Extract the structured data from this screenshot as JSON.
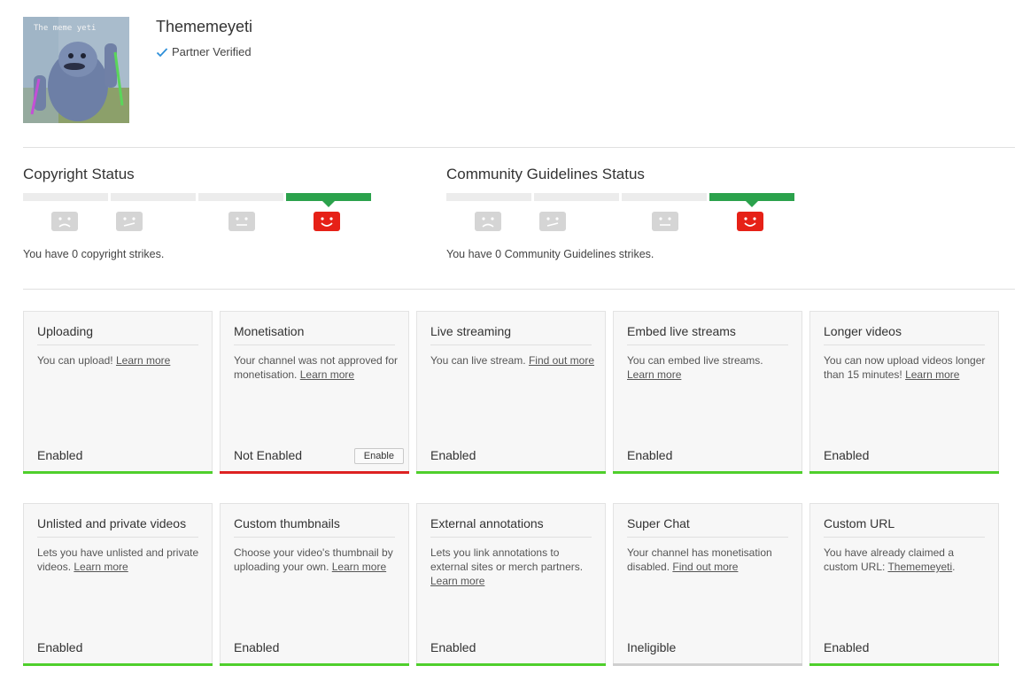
{
  "channel": {
    "name": "Thememeyeti",
    "verified_label": "Partner Verified",
    "avatar_caption": "The meme yeti"
  },
  "colors": {
    "active_strike": "#2ba24c",
    "happy_face": "#e62117",
    "inactive_face": "#d5d5d5",
    "enabled_bar": "#4fcf2c",
    "not_enabled_bar": "#dd2222",
    "ineligible_bar": "#cfcfcf"
  },
  "copyright": {
    "title": "Copyright Status",
    "text": "You have 0 copyright strikes.",
    "active_segment": 4
  },
  "community": {
    "title": "Community Guidelines Status",
    "text": "You have 0 Community Guidelines strikes.",
    "active_segment": 4
  },
  "features": [
    {
      "title": "Uploading",
      "desc": "You can upload! ",
      "link": "Learn more",
      "suffix": "",
      "status": "Enabled"
    },
    {
      "title": "Monetisation",
      "desc": "Your channel was not approved for monetisation. ",
      "link": "Learn more",
      "suffix": "",
      "status": "Not Enabled",
      "button": "Enable"
    },
    {
      "title": "Live streaming",
      "desc": "You can live stream. ",
      "link": "Find out more",
      "suffix": "",
      "status": "Enabled"
    },
    {
      "title": "Embed live streams",
      "desc": "You can embed live streams. ",
      "link": "Learn more",
      "suffix": "",
      "status": "Enabled"
    },
    {
      "title": "Longer videos",
      "desc": "You can now upload videos longer than 15 minutes! ",
      "link": "Learn more",
      "suffix": "",
      "status": "Enabled"
    },
    {
      "title": "Unlisted and private videos",
      "desc": "Lets you have unlisted and private videos. ",
      "link": "Learn more",
      "suffix": "",
      "status": "Enabled"
    },
    {
      "title": "Custom thumbnails",
      "desc": "Choose your video's thumbnail by uploading your own. ",
      "link": "Learn more",
      "suffix": "",
      "status": "Enabled"
    },
    {
      "title": "External annotations",
      "desc": "Lets you link annotations to external sites or merch partners. ",
      "link": "Learn more",
      "suffix": "",
      "status": "Enabled"
    },
    {
      "title": "Super Chat",
      "desc": "Your channel has monetisation disabled. ",
      "link": "Find out more",
      "suffix": "",
      "status": "Ineligible"
    },
    {
      "title": "Custom URL",
      "desc": "You have already claimed a custom URL: ",
      "link": "Thememeyeti",
      "suffix": ".",
      "status": "Enabled"
    }
  ]
}
